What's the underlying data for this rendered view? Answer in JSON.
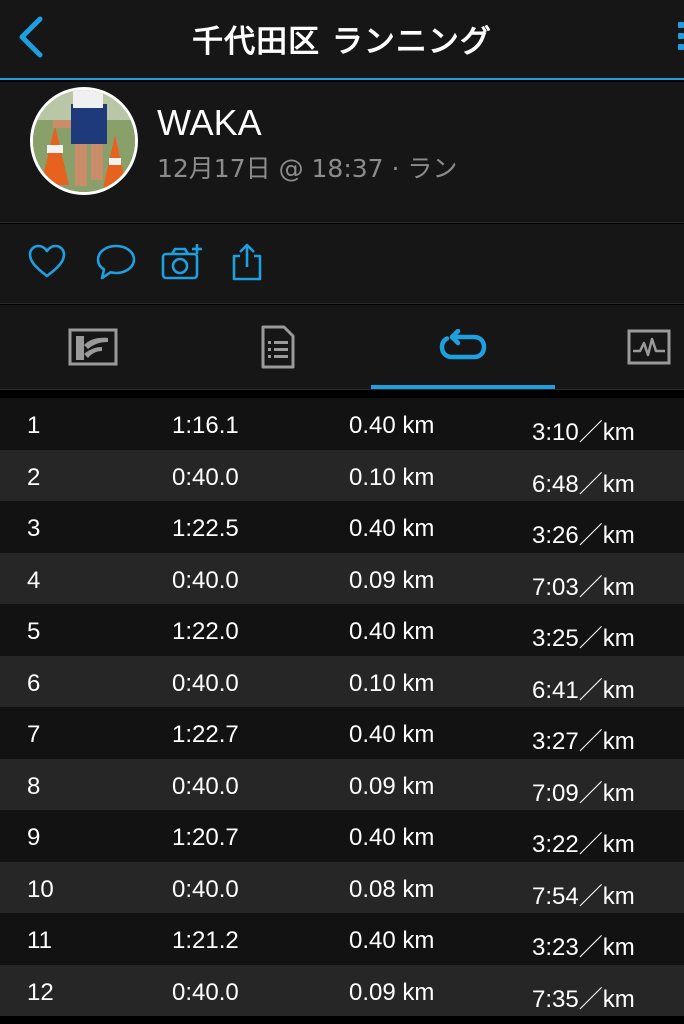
{
  "nav": {
    "title": "千代田区 ランニング"
  },
  "profile": {
    "name": "WAKA",
    "meta": "12月17日 @ 18:37 · ラン"
  },
  "actions": [
    "like-icon",
    "comment-icon",
    "add-photo-icon",
    "share-icon"
  ],
  "tabs": [
    {
      "name": "stats-tab",
      "icon": "stats-chart-icon",
      "active": false
    },
    {
      "name": "details-tab",
      "icon": "document-list-icon",
      "active": false
    },
    {
      "name": "laps-tab",
      "icon": "laps-loop-icon",
      "active": true
    },
    {
      "name": "graph-tab",
      "icon": "heart-rate-graph-icon",
      "active": false
    }
  ],
  "accent_color": "#1e9fe0",
  "laps": [
    {
      "lap": "1",
      "time": "1:16.1",
      "distance": "0.40 km",
      "pace": "3:10／km"
    },
    {
      "lap": "2",
      "time": "0:40.0",
      "distance": "0.10 km",
      "pace": "6:48／km"
    },
    {
      "lap": "3",
      "time": "1:22.5",
      "distance": "0.40 km",
      "pace": "3:26／km"
    },
    {
      "lap": "4",
      "time": "0:40.0",
      "distance": "0.09 km",
      "pace": "7:03／km"
    },
    {
      "lap": "5",
      "time": "1:22.0",
      "distance": "0.40 km",
      "pace": "3:25／km"
    },
    {
      "lap": "6",
      "time": "0:40.0",
      "distance": "0.10 km",
      "pace": "6:41／km"
    },
    {
      "lap": "7",
      "time": "1:22.7",
      "distance": "0.40 km",
      "pace": "3:27／km"
    },
    {
      "lap": "8",
      "time": "0:40.0",
      "distance": "0.09 km",
      "pace": "7:09／km"
    },
    {
      "lap": "9",
      "time": "1:20.7",
      "distance": "0.40 km",
      "pace": "3:22／km"
    },
    {
      "lap": "10",
      "time": "0:40.0",
      "distance": "0.08 km",
      "pace": "7:54／km"
    },
    {
      "lap": "11",
      "time": "1:21.2",
      "distance": "0.40 km",
      "pace": "3:23／km"
    },
    {
      "lap": "12",
      "time": "0:40.0",
      "distance": "0.09 km",
      "pace": "7:35／km"
    }
  ]
}
